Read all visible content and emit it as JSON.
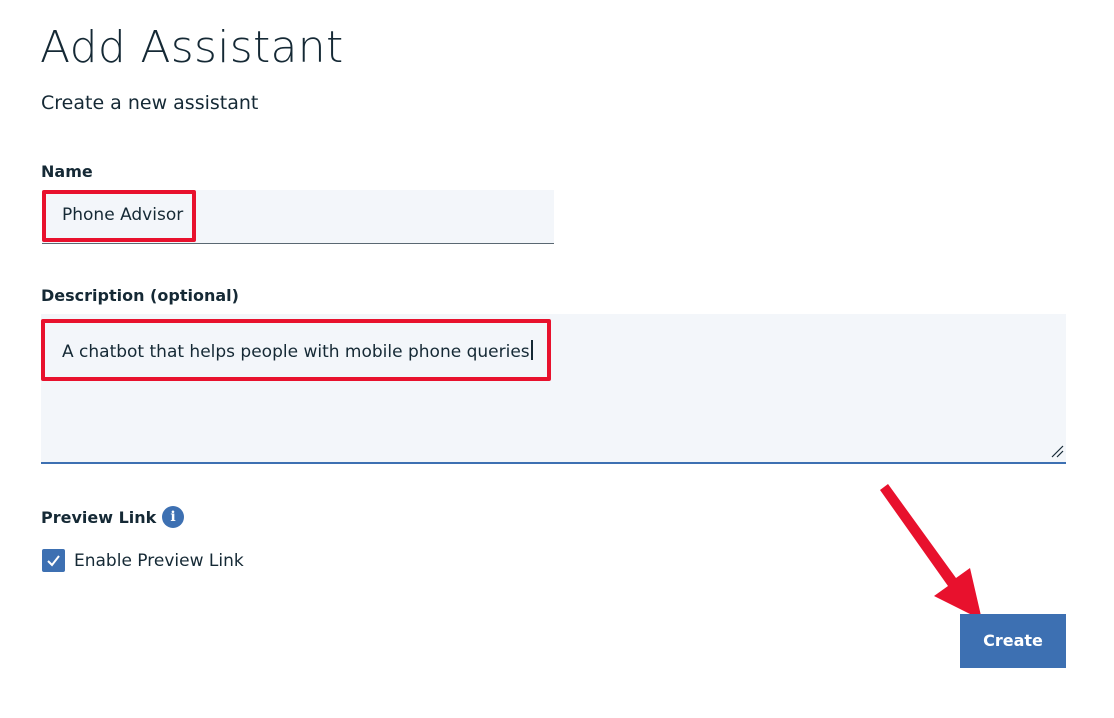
{
  "header": {
    "title": "Add Assistant",
    "subtitle": "Create a new assistant"
  },
  "form": {
    "name": {
      "label": "Name",
      "value": "Phone Advisor"
    },
    "description": {
      "label": "Description (optional)",
      "value": "A chatbot that helps people with mobile phone queries"
    },
    "preview_link": {
      "label": "Preview Link",
      "info_icon": "info-icon",
      "checkbox_label": "Enable Preview Link",
      "checked": true
    }
  },
  "actions": {
    "create_label": "Create"
  },
  "colors": {
    "accent": "#3d70b2",
    "field_bg": "#f3f6fa",
    "highlight": "#e8112d",
    "text": "#152935"
  },
  "annotations": {
    "highlight_boxes": [
      "name-field",
      "description-field"
    ],
    "arrow_target": "create-button"
  }
}
